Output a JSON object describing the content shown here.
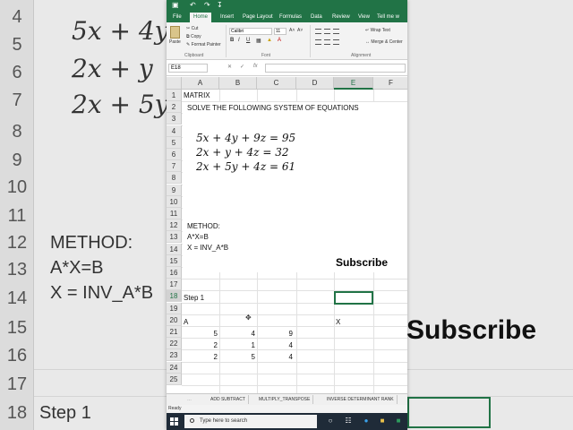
{
  "background": {
    "row_numbers": [
      "4",
      "5",
      "6",
      "7",
      "8",
      "9",
      "10",
      "11",
      "12",
      "13",
      "14",
      "15",
      "16",
      "17",
      "18"
    ],
    "eq_lines": [
      "5x + 4y",
      "2x + y",
      "2x + 5y"
    ],
    "method_lines": [
      "METHOD:",
      "A*X=B",
      "X = INV_A*B"
    ],
    "step_label": "Step 1",
    "subscribe": "Subscribe"
  },
  "window": {
    "tabs": [
      "File",
      "Home",
      "Insert",
      "Page Layout",
      "Formulas",
      "Data",
      "Review",
      "View",
      "Tell me w"
    ],
    "active_tab": "Home",
    "ribbon": {
      "paste": "Paste",
      "cut": "Cut",
      "copy": "Copy",
      "format_painter": "Format Painter",
      "clipboard_group": "Clipboard",
      "font_name": "Calibri",
      "font_size": "11",
      "bold": "B",
      "italic": "I",
      "underline": "U",
      "font_group": "Font",
      "wrap_text": "Wrap Text",
      "merge_center": "Merge & Center",
      "alignment_group": "Alignment"
    },
    "name_box": "E18",
    "fx": "fx"
  },
  "grid": {
    "columns": [
      "A",
      "B",
      "C",
      "D",
      "E",
      "F"
    ],
    "rows": [
      "1",
      "2",
      "3",
      "4",
      "5",
      "6",
      "7",
      "8",
      "9",
      "10",
      "11",
      "12",
      "13",
      "14",
      "15",
      "16",
      "17",
      "18",
      "19",
      "20",
      "21",
      "22",
      "23",
      "24",
      "25"
    ],
    "cells": {
      "a1": "MATRIX",
      "a2": "SOLVE THE FOLLOWING SYSTEM OF EQUATIONS",
      "eq1": "5x + 4y + 9z = 95",
      "eq2": "2x + y + 4z   = 32",
      "eq3": "2x + 5y + 4z = 61",
      "method": "METHOD:",
      "formula1": "A*X=B",
      "formula2": "X = INV_A*B",
      "step": "Step 1",
      "a20": "A",
      "e20": "X"
    },
    "matrix": [
      [
        5,
        4,
        9
      ],
      [
        2,
        1,
        4
      ],
      [
        2,
        5,
        4
      ]
    ],
    "subscribe": "Subscribe"
  },
  "sheet_tabs": [
    "ADD SUBTRACT",
    "MULTIPLY_TRANSPOSE",
    "INVERSE DETERMINANT RANK"
  ],
  "status": "Ready",
  "taskbar": {
    "search_placeholder": "Type here to search"
  }
}
